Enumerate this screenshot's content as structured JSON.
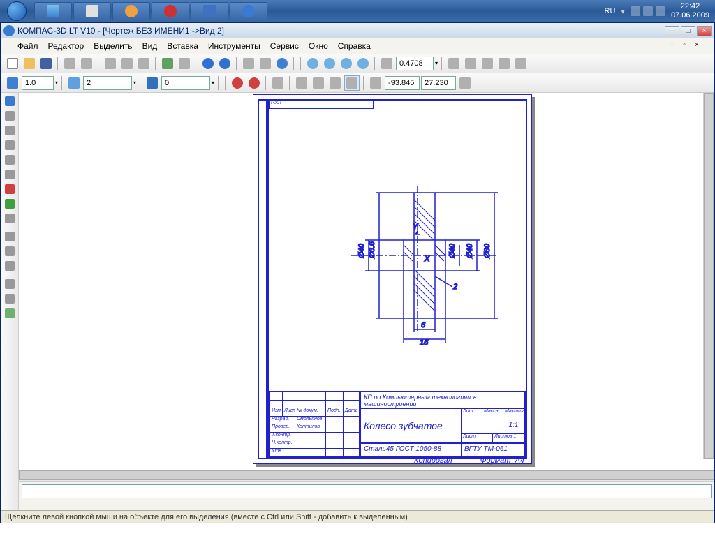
{
  "taskbar": {
    "lang": "RU",
    "time": "22:42",
    "date": "07.06.2009"
  },
  "app": {
    "title": "КОМПАС-3D LT V10 - [Чертеж БЕЗ ИМЕНИ1 ->Вид 2]"
  },
  "menu": {
    "file": "Файл",
    "editor": "Редактор",
    "select": "Выделить",
    "view": "Вид",
    "insert": "Вставка",
    "tools": "Инструменты",
    "service": "Сервис",
    "window": "Окно",
    "help": "Справка"
  },
  "toolbar2": {
    "zoom_value": "0.4708"
  },
  "toolbar3": {
    "val1": "1.0",
    "val2": "2",
    "val3": "0",
    "coord_x": "-93.845",
    "coord_y": "27.230"
  },
  "drawing": {
    "dims": {
      "d1": "∅40",
      "d2": "∅40",
      "d3": "∅40",
      "d4": "∅80",
      "d5": "∅6.6",
      "a1": "2",
      "a2": "6",
      "a3": "15"
    },
    "axes": {
      "x": "X",
      "y": "Y"
    },
    "top_note": "ГОСТ"
  },
  "titleblock": {
    "project": "КП по Компьютерным технологиям в машиностроении",
    "name": "Колесо зубчатое",
    "material": "Сталь45 ГОСТ 1050-88",
    "code": "ВГТУ ТМ-061",
    "scale": "1:1",
    "lit": "Лит.",
    "mass": "Масса",
    "mashtab": "Масштаб",
    "list": "Лист",
    "listov": "Листов 1",
    "dev": "Разраб.",
    "check": "Провер.",
    "tcontr": "Т.контр.",
    "ncontr": "Н.контр.",
    "utv": "Утв.",
    "surname1": "Смольянов",
    "surname2": "Коптилов",
    "izm": "Изм",
    "list2": "Лист",
    "ndoc": "№ докум.",
    "podp": "Подп.",
    "data": "Дата",
    "kopir": "Копировал",
    "format": "Формат",
    "a4": "А4"
  },
  "status": {
    "text": "Щелкните левой кнопкой мыши на объекте для его выделения (вместе с Ctrl или Shift - добавить к выделенным)"
  }
}
